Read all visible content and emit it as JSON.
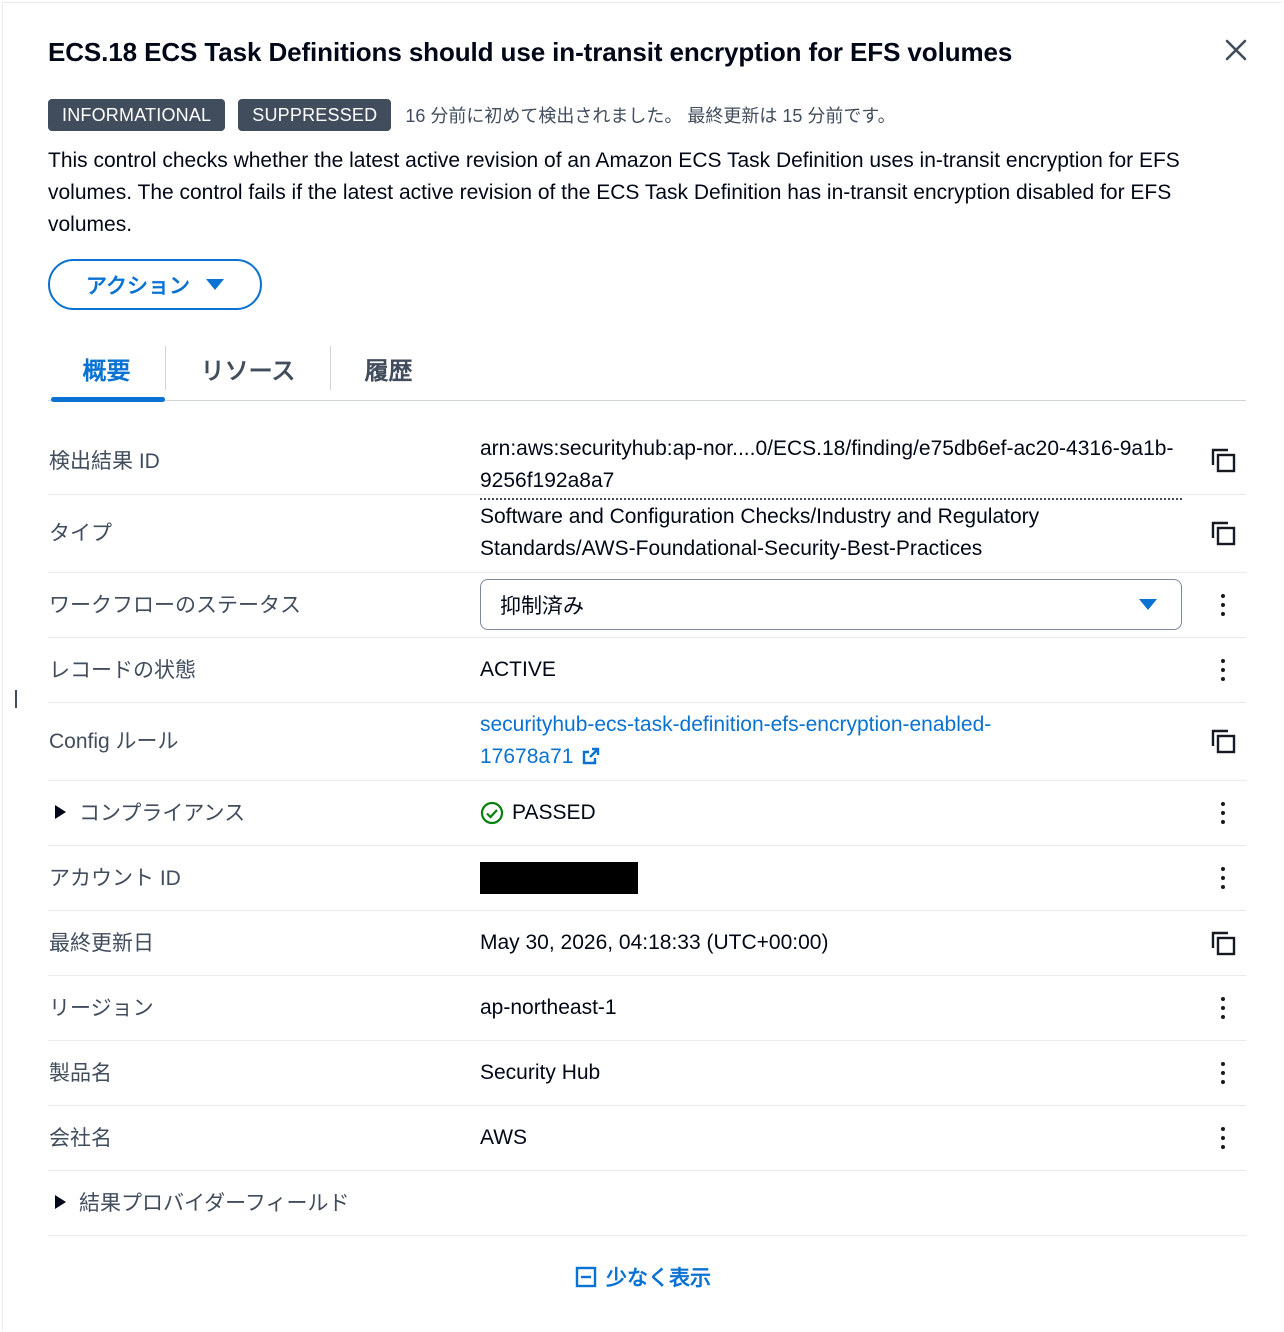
{
  "header": {
    "title": "ECS.18 ECS Task Definitions should use in-transit encryption for EFS volumes",
    "close_icon": "close-icon"
  },
  "badges": {
    "severity": "INFORMATIONAL",
    "workflow": "SUPPRESSED",
    "meta": "16 分前に初めて検出されました。 最終更新は 15 分前です。"
  },
  "description": "This control checks whether the latest active revision of an Amazon ECS Task Definition uses in-transit encryption for EFS volumes. The control fails if the latest active revision of the ECS Task Definition has in-transit encryption disabled for EFS volumes.",
  "actions": {
    "label": "アクション"
  },
  "tabs": [
    {
      "label": "概要",
      "active": true
    },
    {
      "label": "リソース",
      "active": false
    },
    {
      "label": "履歴",
      "active": false
    }
  ],
  "details": {
    "finding_id": {
      "label": "検出結果 ID",
      "value": "arn:aws:securityhub:ap-nor....0/ECS.18/finding/e75db6ef-ac20-4316-9a1b-9256f192a8a7"
    },
    "type": {
      "label": "タイプ",
      "value": "Software and Configuration Checks/Industry and Regulatory Standards/AWS-Foundational-Security-Best-Practices"
    },
    "workflow_status": {
      "label": "ワークフローのステータス",
      "value": "抑制済み"
    },
    "record_state": {
      "label": "レコードの状態",
      "value": "ACTIVE"
    },
    "config_rule": {
      "label": "Config ルール",
      "value": "securityhub-ecs-task-definition-efs-encryption-enabled-17678a71"
    },
    "compliance": {
      "label": "コンプライアンス",
      "value": "PASSED"
    },
    "account_id": {
      "label": "アカウント ID",
      "value": ""
    },
    "last_updated": {
      "label": "最終更新日",
      "value": "May 30, 2026, 04:18:33 (UTC+00:00)"
    },
    "region": {
      "label": "リージョン",
      "value": "ap-northeast-1"
    },
    "product_name": {
      "label": "製品名",
      "value": "Security Hub"
    },
    "company_name": {
      "label": "会社名",
      "value": "AWS"
    },
    "provider_fields": {
      "label": "結果プロバイダーフィールド"
    }
  },
  "footer": {
    "show_less": "少なく表示"
  },
  "colors": {
    "accent": "#0972d3",
    "badge_bg": "#414d5c",
    "passed": "#037f0c"
  }
}
